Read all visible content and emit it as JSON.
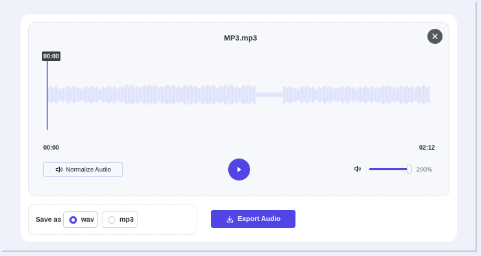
{
  "editor": {
    "filename": "MP3.mp3",
    "current_time_tag": "00:00",
    "time_start": "00:00",
    "time_end": "02:12",
    "normalize_label": "Normalize Audio",
    "volume_value": "200%",
    "volume_level_percent": 100,
    "playhead_fraction": 0
  },
  "save": {
    "label": "Save as",
    "options": [
      {
        "label": "wav",
        "selected": true
      },
      {
        "label": "mp3",
        "selected": false
      }
    ]
  },
  "export": {
    "label": "Export Audio"
  },
  "colors": {
    "accent": "#4f46e5",
    "waveform": "#dde2fa",
    "playhead": "#4f46e5"
  },
  "icons": {
    "close": "close-icon",
    "normalize": "speaker-icon",
    "play": "play-icon",
    "volume": "volume-icon",
    "export": "download-icon"
  }
}
